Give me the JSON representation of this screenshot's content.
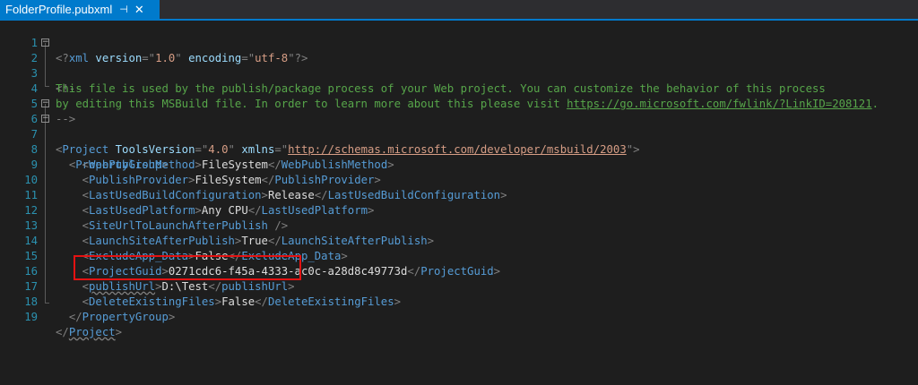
{
  "tab": {
    "title": "FolderProfile.pubxml",
    "pin": "⊣",
    "close": "✕"
  },
  "lines": {
    "l1": {
      "num": "1",
      "p1": "<?",
      "p2": "xml",
      "p3": " version",
      "p4": "=\"",
      "p5": "1.0",
      "p6": "\"",
      "p7": " encoding",
      "p8": "=\"",
      "p9": "utf-8",
      "p10": "\"",
      "p11": "?>"
    },
    "l2": {
      "num": "2",
      "p1": "<!--"
    },
    "l3": {
      "num": "3",
      "p1": "This file is used by the publish/package process of your Web project. You can customize the behavior of this process"
    },
    "l4": {
      "num": "4",
      "p1": "by editing this MSBuild file. In order to learn more about this please visit ",
      "p2": "https://go.microsoft.com/fwlink/?LinkID=208121",
      "p3": "."
    },
    "l5": {
      "num": "5",
      "p1": "-->"
    },
    "l6": {
      "num": "6",
      "p1": "<",
      "p2": "Project",
      "p3": " ToolsVersion",
      "p4": "=\"",
      "p5": "4.0",
      "p6": "\"",
      "p7": " xmlns",
      "p8": "=\"",
      "p9": "http://schemas.microsoft.com/developer/msbuild/2003",
      "p10": "\"",
      "p11": ">"
    },
    "l7": {
      "num": "7",
      "p1": "<",
      "p2": "PropertyGroup",
      "p3": ">"
    },
    "l8": {
      "num": "8",
      "p1": "<",
      "p2": "WebPublishMethod",
      "p3": ">",
      "p4": "FileSystem",
      "p5": "</",
      "p6": "WebPublishMethod",
      "p7": ">"
    },
    "l9": {
      "num": "9",
      "p1": "<",
      "p2": "PublishProvider",
      "p3": ">",
      "p4": "FileSystem",
      "p5": "</",
      "p6": "PublishProvider",
      "p7": ">"
    },
    "l10": {
      "num": "10",
      "p1": "<",
      "p2": "LastUsedBuildConfiguration",
      "p3": ">",
      "p4": "Release",
      "p5": "</",
      "p6": "LastUsedBuildConfiguration",
      "p7": ">"
    },
    "l11": {
      "num": "11",
      "p1": "<",
      "p2": "LastUsedPlatform",
      "p3": ">",
      "p4": "Any CPU",
      "p5": "</",
      "p6": "LastUsedPlatform",
      "p7": ">"
    },
    "l12": {
      "num": "12",
      "p1": "<",
      "p2": "SiteUrlToLaunchAfterPublish",
      "p3": " />"
    },
    "l13": {
      "num": "13",
      "p1": "<",
      "p2": "LaunchSiteAfterPublish",
      "p3": ">",
      "p4": "True",
      "p5": "</",
      "p6": "LaunchSiteAfterPublish",
      "p7": ">"
    },
    "l14": {
      "num": "14",
      "p1": "<",
      "p2": "ExcludeApp_Data",
      "p3": ">",
      "p4": "False",
      "p5": "</",
      "p6": "ExcludeApp_Data",
      "p7": ">"
    },
    "l15": {
      "num": "15",
      "p1": "<",
      "p2": "ProjectGuid",
      "p3": ">",
      "p4": "0271cdc6-f45a-4333-ac0c-a28d8c49773d",
      "p5": "</",
      "p6": "ProjectGuid",
      "p7": ">"
    },
    "l16": {
      "num": "16",
      "p1": "<",
      "p2": "publishUrl",
      "p3": ">",
      "p4": "D:\\Test",
      "p5": "</",
      "p6": "publishUrl",
      "p7": ">"
    },
    "l17": {
      "num": "17",
      "p1": "<",
      "p2": "DeleteExistingFiles",
      "p3": ">",
      "p4": "False",
      "p5": "</",
      "p6": "DeleteExistingFiles",
      "p7": ">"
    },
    "l18": {
      "num": "18",
      "p1": "</",
      "p2": "PropertyGroup",
      "p3": ">"
    },
    "l19": {
      "num": "19",
      "p1": "</",
      "p2": "Project",
      "p3": ">"
    }
  },
  "fold_icon": "−",
  "colors": {
    "tab_accent": "#007acc",
    "editor_bg": "#1e1e1e",
    "highlight_box": "#e41212"
  }
}
